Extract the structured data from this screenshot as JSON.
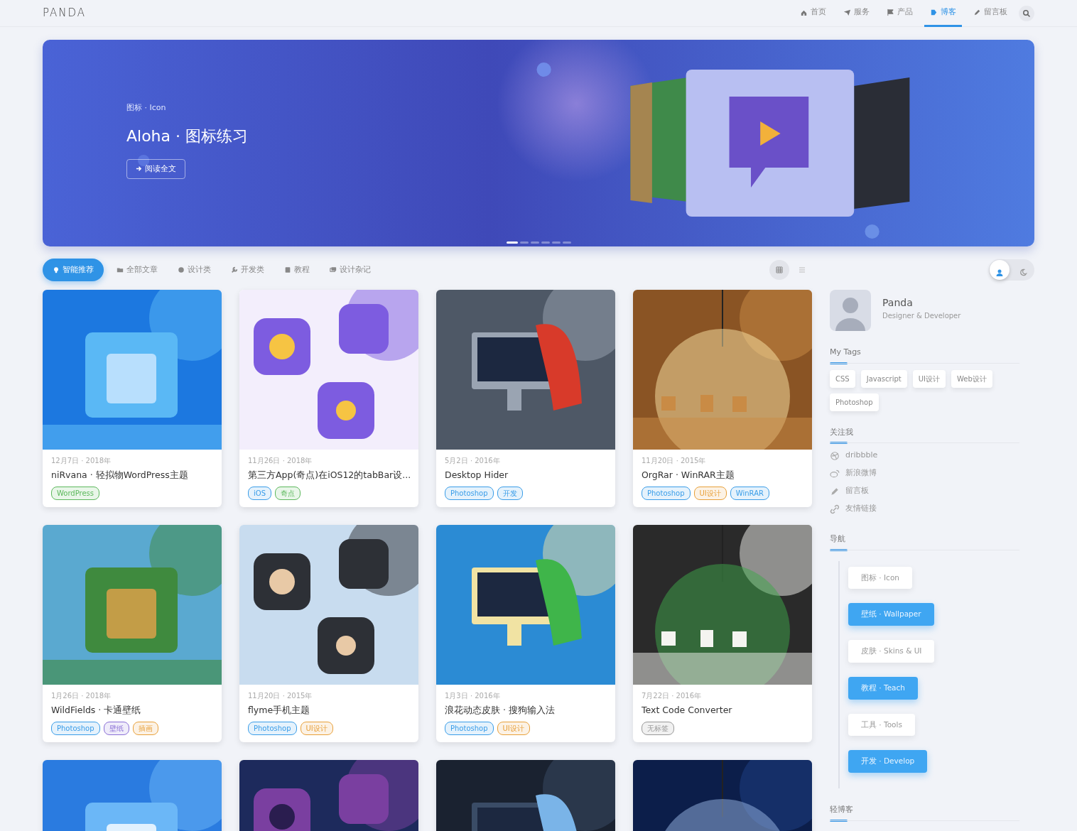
{
  "header": {
    "logo": "PANDA",
    "nav": [
      {
        "label": "首页",
        "selected": false
      },
      {
        "label": "服务",
        "selected": false
      },
      {
        "label": "产品",
        "selected": false
      },
      {
        "label": "博客",
        "selected": true
      },
      {
        "label": "留言板",
        "selected": false
      }
    ]
  },
  "banner": {
    "kicker": "图标 · Icon",
    "title": "Aloha · 图标练习",
    "button": "阅读全文",
    "slides": [
      {
        "selected": true
      },
      {
        "selected": false
      },
      {
        "selected": false
      },
      {
        "selected": false
      },
      {
        "selected": false
      },
      {
        "selected": false
      }
    ]
  },
  "filters": [
    {
      "label": "智能推荐",
      "selected": true
    },
    {
      "label": "全部文章",
      "selected": false
    },
    {
      "label": "设计类",
      "selected": false
    },
    {
      "label": "开发类",
      "selected": false
    },
    {
      "label": "教程",
      "selected": false
    },
    {
      "label": "设计杂记",
      "selected": false
    }
  ],
  "views": [
    {
      "kind": "grid",
      "selected": true
    },
    {
      "kind": "list",
      "selected": false
    }
  ],
  "mode_switch": {
    "on": false
  },
  "posts": [
    {
      "kind": "picture",
      "date": "12月7日 · 2018年",
      "title": "niRvana · 轻拟物WordPress主题",
      "tags": [
        {
          "label": "WordPress",
          "color": "#5cb85c"
        }
      ]
    },
    {
      "kind": "picture",
      "date": "11月26日 · 2018年",
      "title": "第三方App(奇点)在iOS12的tabBar设...",
      "tags": [
        {
          "label": "iOS",
          "color": "#3a9de8"
        },
        {
          "label": "奇点",
          "color": "#5cb85c"
        }
      ]
    },
    {
      "kind": "picture",
      "date": "5月2日 · 2016年",
      "title": "Desktop Hider",
      "tags": [
        {
          "label": "Photoshop",
          "color": "#3a9de8"
        },
        {
          "label": "开发",
          "color": "#3a9de8"
        }
      ]
    },
    {
      "kind": "picture",
      "date": "11月20日 · 2015年",
      "title": "OrgRar · WinRAR主题",
      "tags": [
        {
          "label": "Photoshop",
          "color": "#3a9de8"
        },
        {
          "label": "UI设计",
          "color": "#e8a03a"
        },
        {
          "label": "WinRAR",
          "color": "#3a9de8"
        }
      ]
    },
    {
      "kind": "picture",
      "date": "1月26日 · 2018年",
      "title": "WildFields · 卡通壁纸",
      "tags": [
        {
          "label": "Photoshop",
          "color": "#3a9de8"
        },
        {
          "label": "壁纸",
          "color": "#8a6fd6"
        },
        {
          "label": "插画",
          "color": "#e8a03a"
        }
      ]
    },
    {
      "kind": "picture",
      "date": "11月20日 · 2015年",
      "title": "flyme手机主题",
      "tags": [
        {
          "label": "Photoshop",
          "color": "#3a9de8"
        },
        {
          "label": "UI设计",
          "color": "#e8a03a"
        }
      ]
    },
    {
      "kind": "picture",
      "date": "1月3日 · 2016年",
      "title": "浪花动态皮肤 · 搜狗输入法",
      "tags": [
        {
          "label": "Photoshop",
          "color": "#3a9de8"
        },
        {
          "label": "UI设计",
          "color": "#e8a03a"
        }
      ]
    },
    {
      "kind": "picture",
      "date": "7月22日 · 2016年",
      "title": "Text Code Converter",
      "tags": [
        {
          "label": "无标签",
          "color": "#999999"
        }
      ]
    },
    {
      "kind": "picture"
    },
    {
      "kind": "picture"
    },
    {
      "kind": "picture"
    },
    {
      "kind": "picture"
    }
  ],
  "profile": {
    "name": "Panda",
    "role": "Designer & Developer"
  },
  "my_tags": {
    "title": "My Tags",
    "tags": [
      "CSS",
      "Javascript",
      "UI设计",
      "Web设计",
      "Photoshop"
    ]
  },
  "follow": {
    "title": "关注我",
    "links": [
      {
        "label": "dribbble"
      },
      {
        "label": "新浪微博"
      },
      {
        "label": "留言板"
      },
      {
        "label": "友情链接"
      }
    ]
  },
  "guide": {
    "title": "导航",
    "items": [
      {
        "label": "图标 · Icon",
        "selected": false
      },
      {
        "label": "壁纸 · Wallpaper",
        "selected": true
      },
      {
        "label": "皮肤 · Skins & UI",
        "selected": false
      },
      {
        "label": "教程 · Teach",
        "selected": true
      },
      {
        "label": "工具 · Tools",
        "selected": false
      },
      {
        "label": "开发 · Develop",
        "selected": true
      }
    ]
  },
  "light_blog": {
    "title": "轻博客"
  }
}
